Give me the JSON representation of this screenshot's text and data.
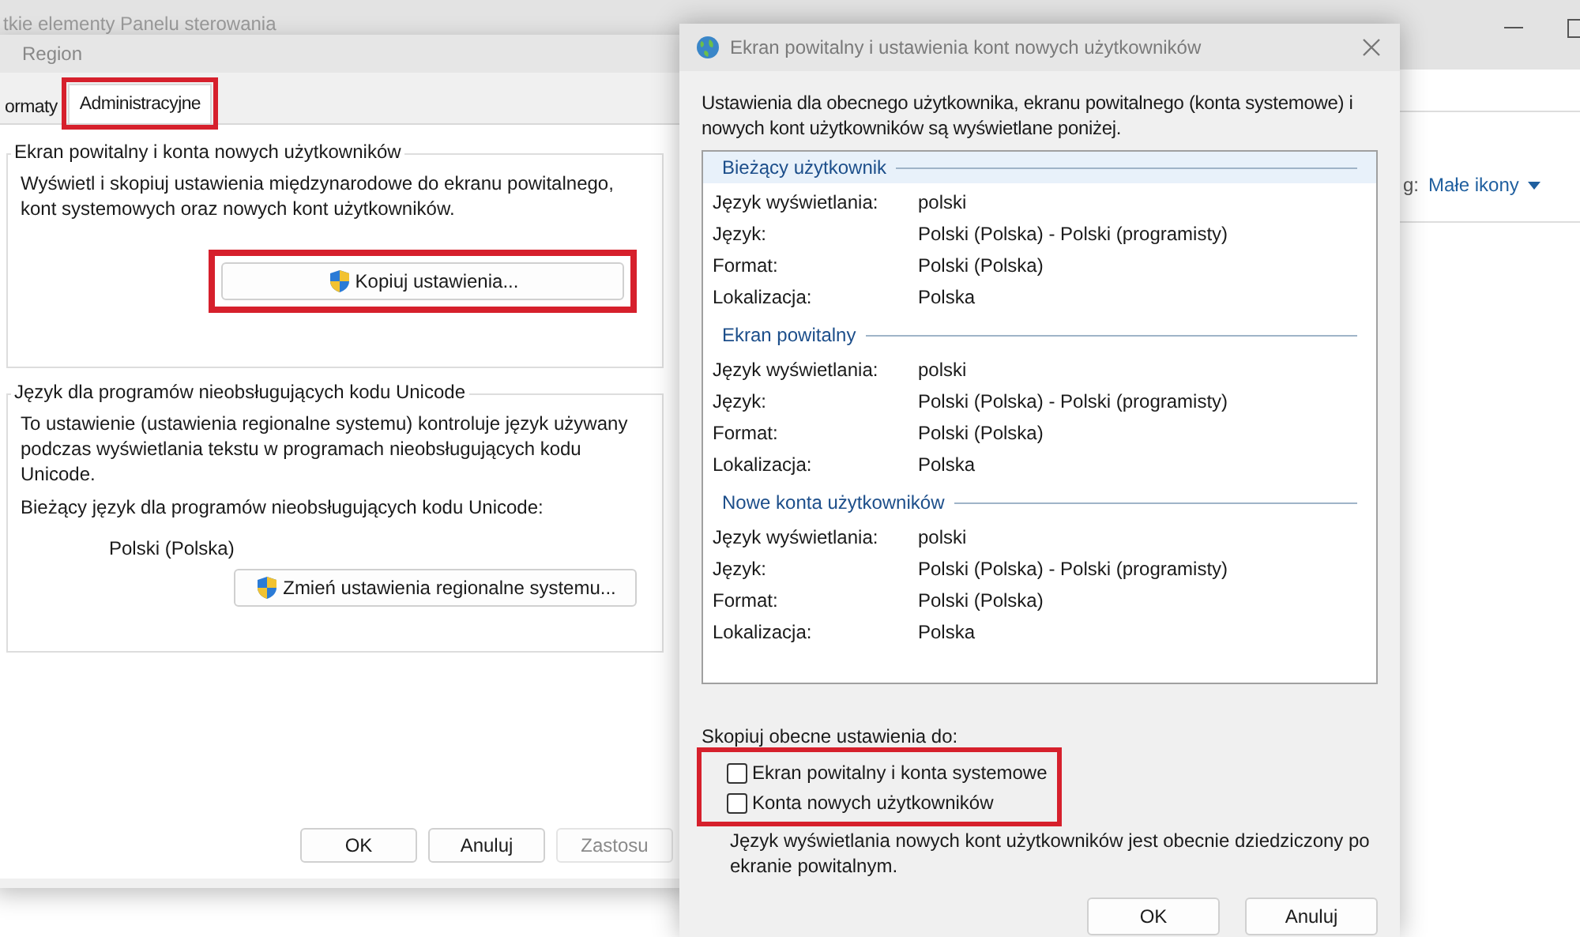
{
  "background_window": {
    "title": "tkie elementy Panelu sterowania",
    "view_label": "g:",
    "view_dropdown": "Małe ikony"
  },
  "region_window": {
    "title": "Region",
    "tabs": [
      {
        "label": "ormaty",
        "selected": false,
        "highlighted": false
      },
      {
        "label": "Administracyjne",
        "selected": true,
        "highlighted": true
      }
    ],
    "welcome_group": {
      "title": "Ekran powitalny i konta nowych użytkowników",
      "description": "Wyświetl i skopiuj ustawienia międzynarodowe do ekranu powitalnego, kont systemowych oraz nowych kont użytkowników.",
      "button": "Kopiuj ustawienia...",
      "button_highlighted": true
    },
    "unicode_group": {
      "title": "Język dla programów nieobsługujących kodu Unicode",
      "description": "To ustawienie (ustawienia regionalne systemu) kontroluje język używany podczas wyświetlania tekstu w programach nieobsługujących kodu Unicode.",
      "current_label": "Bieżący język dla programów nieobsługujących kodu Unicode:",
      "current_value": "Polski (Polska)",
      "button": "Zmień ustawienia regionalne systemu..."
    },
    "buttons": [
      {
        "label": "OK",
        "disabled": false
      },
      {
        "label": "Anuluj",
        "disabled": false
      },
      {
        "label": "Zastosu",
        "disabled": true
      }
    ]
  },
  "dialog": {
    "title": "Ekran powitalny i ustawienia kont nowych użytkowników",
    "intro": "Ustawienia dla obecnego użytkownika, ekranu powitalnego (konta systemowe) i nowych kont użytkowników są wyświetlane poniżej.",
    "sections": [
      {
        "title": "Bieżący użytkownik",
        "selected": true,
        "rows": [
          {
            "label": "Język wyświetlania:",
            "value": "polski"
          },
          {
            "label": "Język:",
            "value": "Polski (Polska) - Polski (programisty)"
          },
          {
            "label": "Format:",
            "value": "Polski (Polska)"
          },
          {
            "label": "Lokalizacja:",
            "value": "Polska"
          }
        ]
      },
      {
        "title": "Ekran powitalny",
        "selected": false,
        "rows": [
          {
            "label": "Język wyświetlania:",
            "value": "polski"
          },
          {
            "label": "Język:",
            "value": "Polski (Polska) - Polski (programisty)"
          },
          {
            "label": "Format:",
            "value": "Polski (Polska)"
          },
          {
            "label": "Lokalizacja:",
            "value": "Polska"
          }
        ]
      },
      {
        "title": "Nowe konta użytkowników",
        "selected": false,
        "rows": [
          {
            "label": "Język wyświetlania:",
            "value": "polski"
          },
          {
            "label": "Język:",
            "value": "Polski (Polska) - Polski (programisty)"
          },
          {
            "label": "Format:",
            "value": "Polski (Polska)"
          },
          {
            "label": "Lokalizacja:",
            "value": "Polska"
          }
        ]
      }
    ],
    "copy_label": "Skopiuj obecne ustawienia do:",
    "copy_options_highlighted": true,
    "copy_options": [
      {
        "label": "Ekran powitalny i konta systemowe",
        "checked": false
      },
      {
        "label": "Konta nowych użytkowników",
        "checked": false
      }
    ],
    "note": "Język wyświetlania nowych kont użytkowników jest obecnie dziedziczony po ekranie powitalnym.",
    "buttons": [
      {
        "label": "OK"
      },
      {
        "label": "Anuluj"
      }
    ]
  }
}
